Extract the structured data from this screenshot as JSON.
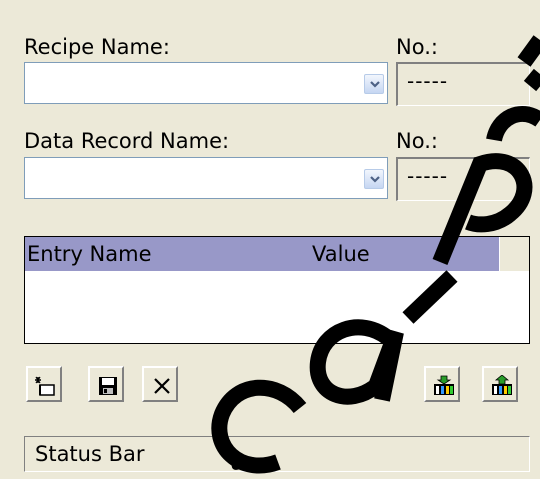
{
  "recipe": {
    "name_label": "Recipe Name:",
    "name_value": "",
    "no_label": "No.:",
    "no_value": "-----"
  },
  "data_record": {
    "name_label": "Data Record Name:",
    "name_value": "",
    "no_label": "No.:",
    "no_value": "-----"
  },
  "entries_table": {
    "columns": [
      "Entry Name",
      "Value"
    ],
    "rows": []
  },
  "toolbar": {
    "buttons": [
      "new-icon",
      "save-icon",
      "delete-icon",
      "import-icon",
      "export-icon"
    ]
  },
  "status_bar": {
    "text": "Status Bar"
  },
  "colors": {
    "background": "#ece9d8",
    "header_bg": "#9898c8",
    "field_border": "#7f9db9"
  }
}
